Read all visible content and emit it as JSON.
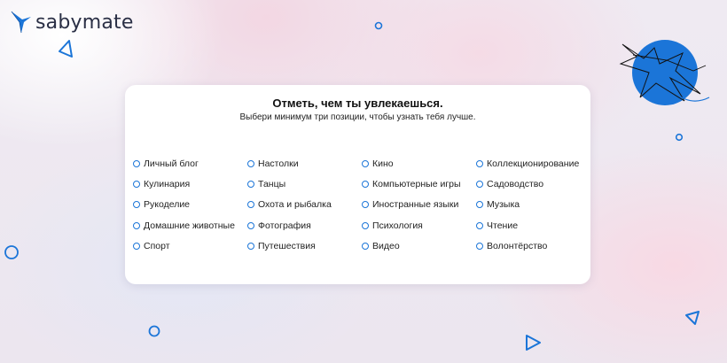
{
  "brand": {
    "name": "sabymate",
    "accent": "#1b75d8"
  },
  "card": {
    "title": "Отметь, чем ты увлекаешься.",
    "subtitle": "Выбери минимум три позиции, чтобы узнать тебя лучше."
  },
  "options": {
    "col1": [
      "Личный блог",
      "Кулинария",
      "Рукоделие",
      "Домашние животные",
      "Спорт"
    ],
    "col2": [
      "Настолки",
      "Танцы",
      "Охота и рыбалка",
      "Фотография",
      "Путешествия"
    ],
    "col3": [
      "Кино",
      "Компьютерные игры",
      "Иностранные языки",
      "Психология",
      "Видео"
    ],
    "col4": [
      "Коллекционирование",
      "Садоводство",
      "Музыка",
      "Чтение",
      "Волонтёрство"
    ]
  }
}
